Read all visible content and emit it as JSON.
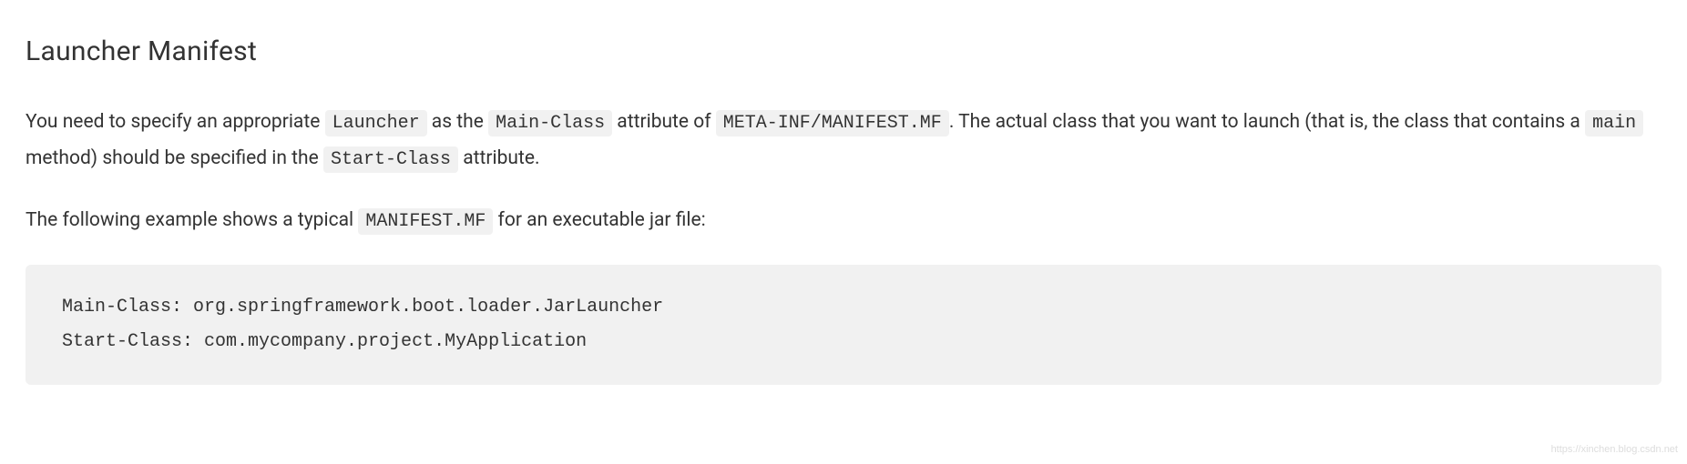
{
  "heading": "Launcher Manifest",
  "paragraph1": {
    "text1": "You need to specify an appropriate ",
    "code1": "Launcher",
    "text2": " as the ",
    "code2": "Main-Class",
    "text3": " attribute of ",
    "code3": "META-INF/MANIFEST.MF",
    "text4": ". The actual class that you want to launch (that is, the class that contains a ",
    "code4": "main",
    "text5": " method) should be specified in the ",
    "code5": "Start-Class",
    "text6": " attribute."
  },
  "paragraph2": {
    "text1": "The following example shows a typical ",
    "code1": "MANIFEST.MF",
    "text2": " for an executable jar file:"
  },
  "codeblock": "Main-Class: org.springframework.boot.loader.JarLauncher\nStart-Class: com.mycompany.project.MyApplication",
  "watermark": "https://xinchen.blog.csdn.net"
}
